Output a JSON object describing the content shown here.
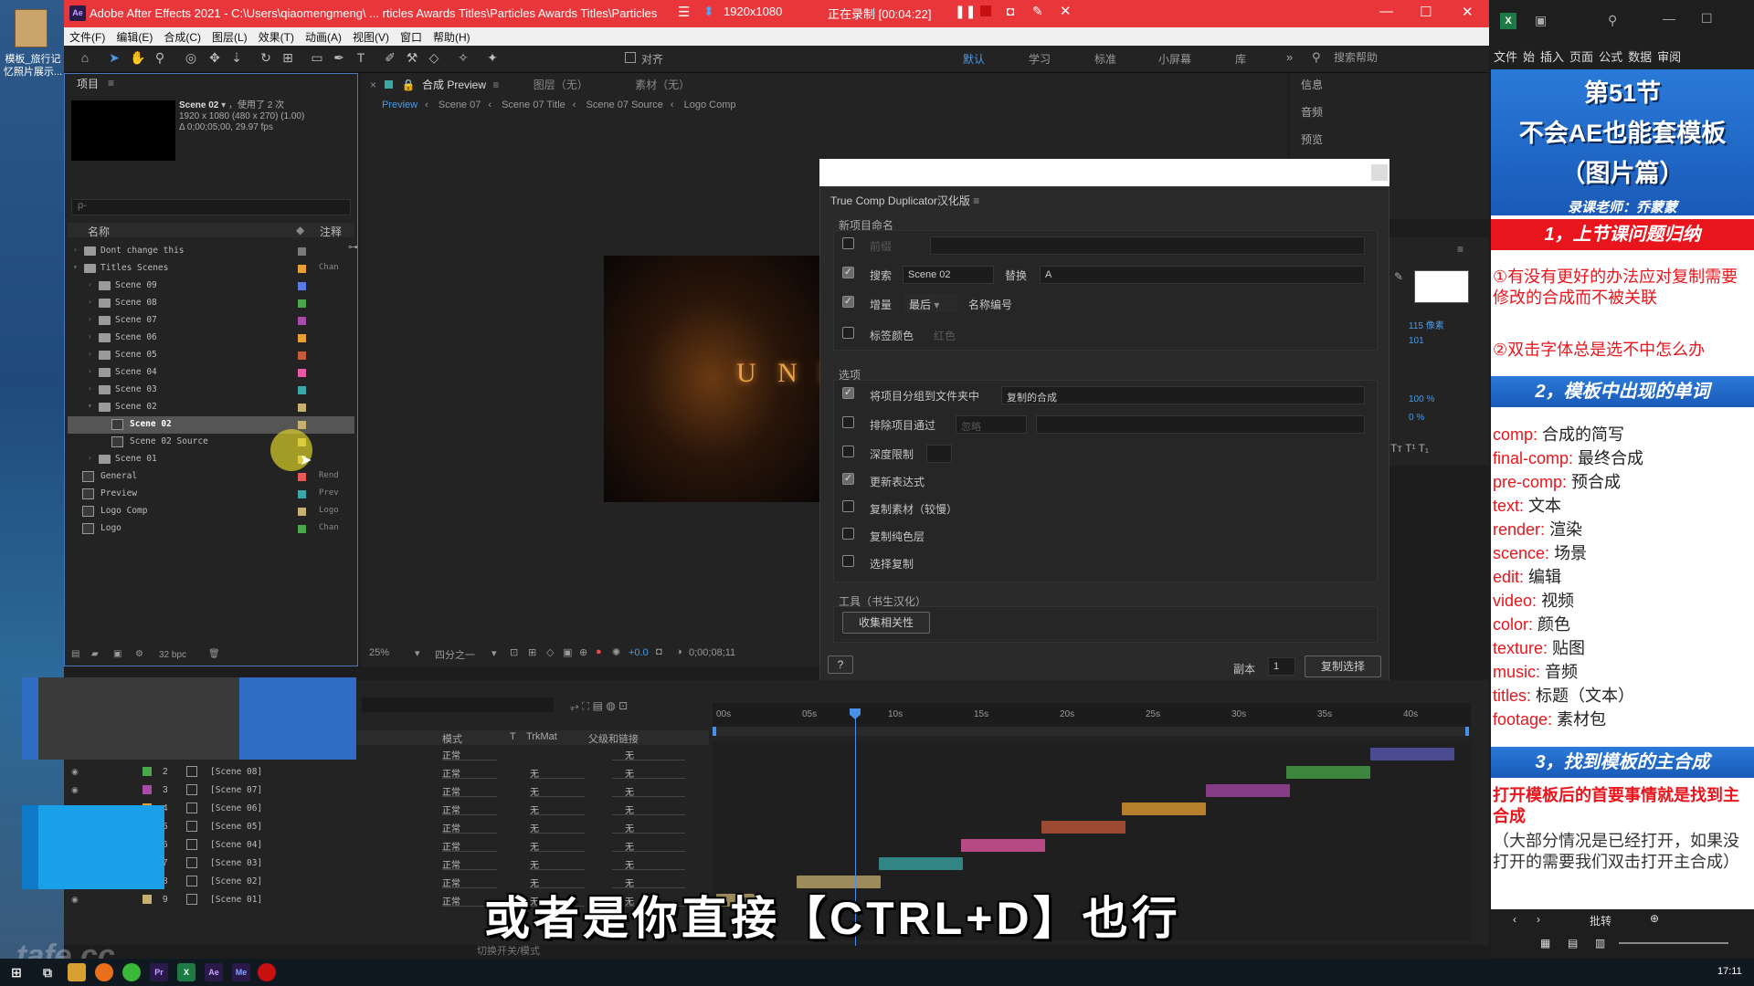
{
  "desktop": {
    "icon_label": "模板_旅行记忆照片展示..."
  },
  "ae": {
    "title": "Adobe After Effects 2021 - C:\\Users\\qiaomengmeng\\ ... rticles Awards Titles\\Particles Awards Titles\\Particles",
    "logo": "Ae",
    "recording": {
      "resolution": "1920x1080",
      "status": "正在录制 [00:04:22]"
    },
    "menu": [
      "文件(F)",
      "编辑(E)",
      "合成(C)",
      "图层(L)",
      "效果(T)",
      "动画(A)",
      "视图(V)",
      "窗口",
      "帮助(H)"
    ],
    "toolbar": {
      "align_label": "对齐",
      "workspaces": [
        "默认",
        "学习",
        "标准",
        "小屏幕",
        "库"
      ],
      "search_placeholder": "搜索帮助"
    }
  },
  "project": {
    "tab": "项目",
    "comp_name": "Scene 02",
    "comp_usage": "，使用了 2 次",
    "comp_size": "1920 x 1080 (480 x 270) (1.00)",
    "comp_duration": "Δ 0;00;05;00, 29.97 fps",
    "search_placeholder": "ρ-",
    "col_name": "名称",
    "col_note": "注释",
    "rows": [
      {
        "name": "Dont change this",
        "type": "folder",
        "indent": 0,
        "color": "#7a7a7a",
        "note": ""
      },
      {
        "name": "Titles Scenes",
        "type": "folder",
        "indent": 0,
        "color": "#e8a030",
        "note": "Chan"
      },
      {
        "name": "Scene 09",
        "type": "folder",
        "indent": 1,
        "color": "#5a7ae8",
        "note": ""
      },
      {
        "name": "Scene 08",
        "type": "folder",
        "indent": 1,
        "color": "#4aa84a",
        "note": ""
      },
      {
        "name": "Scene 07",
        "type": "folder",
        "indent": 1,
        "color": "#a84aa8",
        "note": ""
      },
      {
        "name": "Scene 06",
        "type": "folder",
        "indent": 1,
        "color": "#e8a030",
        "note": ""
      },
      {
        "name": "Scene 05",
        "type": "folder",
        "indent": 1,
        "color": "#c85a3a",
        "note": ""
      },
      {
        "name": "Scene 04",
        "type": "folder",
        "indent": 1,
        "color": "#e85aa8",
        "note": ""
      },
      {
        "name": "Scene 03",
        "type": "folder",
        "indent": 1,
        "color": "#3aa8a8",
        "note": ""
      },
      {
        "name": "Scene 02",
        "type": "folder",
        "indent": 1,
        "color": "#c8b070",
        "note": ""
      },
      {
        "name": "Scene 02",
        "type": "comp",
        "indent": 2,
        "color": "#c8b070",
        "note": "",
        "selected": true
      },
      {
        "name": "Scene 02 Source",
        "type": "comp",
        "indent": 2,
        "color": "#c8b070",
        "note": ""
      },
      {
        "name": "Scene 01",
        "type": "folder",
        "indent": 1,
        "color": "#c8b070",
        "note": ""
      },
      {
        "name": "General",
        "type": "comp",
        "indent": 0,
        "color": "#e85a5a",
        "note": "Rend"
      },
      {
        "name": "Preview",
        "type": "comp",
        "indent": 0,
        "color": "#3aa8a8",
        "note": "Prev"
      },
      {
        "name": "Logo Comp",
        "type": "comp",
        "indent": 0,
        "color": "#c8b070",
        "note": "Logo"
      },
      {
        "name": "Logo",
        "type": "comp",
        "indent": 0,
        "color": "#4aa84a",
        "note": "Chan"
      }
    ],
    "bpc": "32 bpc"
  },
  "comp": {
    "tab_label": "合成 Preview",
    "tab_layer": "图层（无）",
    "tab_footage": "素材（无）",
    "breadcrumb": [
      "Preview",
      "Scene 07",
      "Scene 07 Title",
      "Scene 07 Source",
      "Logo Comp"
    ],
    "viewer_text": "U N I",
    "zoom": "25%",
    "resolution": "四分之一",
    "exposure": "+0.0",
    "timecode": "0;00;08;11"
  },
  "info_panel": {
    "items": [
      "信息",
      "音频",
      "预览"
    ],
    "font_size": "115 像素",
    "tracking": "101",
    "scale_v": "100 %",
    "baseline": "0 %"
  },
  "dialog": {
    "title": "True Comp Duplicator汉化版",
    "section_rename": "新项目命名",
    "prefix_label": "前缀",
    "search_label": "搜索",
    "search_value": "Scene 02",
    "replace_label": "替换",
    "replace_value": "A",
    "increment_label": "增量",
    "increment_value": "最后",
    "increment_name": "名称编号",
    "label_color_label": "标签颜色",
    "label_color_value": "红色",
    "section_options": "选项",
    "group_label": "将项目分组到文件夹中",
    "group_value": "复制的合成",
    "exclude_label": "排除项目通过",
    "exclude_value": "忽略",
    "depth_label": "深度限制",
    "update_expr_label": "更新表达式",
    "dup_footage_label": "复制素材（较慢）",
    "dup_solids_label": "复制纯色层",
    "selective_label": "选择复制",
    "section_tools": "工具（书生汉化）",
    "collect_button": "收集相关性",
    "help_button": "?",
    "copies_label": "副本",
    "copies_value": "1",
    "duplicate_button": "复制选择"
  },
  "timeline": {
    "col_mode": "模式",
    "col_t": "T",
    "col_trkmat": "TrkMat",
    "col_parent": "父级和链接",
    "ruler": [
      "00s",
      "05s",
      "10s",
      "15s",
      "20s",
      "25s",
      "30s",
      "35s",
      "40s"
    ],
    "mode_value": "正常",
    "none_value": "无",
    "layers": [
      {
        "num": "",
        "name": "",
        "color": "#5a5ab8"
      },
      {
        "num": "2",
        "name": "[Scene 08]",
        "color": "#4aa84a"
      },
      {
        "num": "3",
        "name": "[Scene 07]",
        "color": "#a84aa8"
      },
      {
        "num": "4",
        "name": "[Scene 06]",
        "color": "#e8a030"
      },
      {
        "num": "5",
        "name": "[Scene 05]",
        "color": "#c85a3a"
      },
      {
        "num": "6",
        "name": "[Scene 04]",
        "color": "#e85aa8"
      },
      {
        "num": "7",
        "name": "[Scene 03]",
        "color": "#3aa8a8"
      },
      {
        "num": "8",
        "name": "[Scene 02]",
        "color": "#c8b070"
      },
      {
        "num": "9",
        "name": "[Scene 01]",
        "color": "#c8b070"
      }
    ],
    "footer_toggle": "切换开关/模式"
  },
  "subtitle": "或者是你直接【CTRL+D】也行",
  "watermark": "tafe.cc",
  "notes": {
    "ribbon": [
      "文件",
      "始",
      "插入",
      "页面",
      "公式",
      "数据",
      "审阅"
    ],
    "h1": "第51节",
    "h2": "不会AE也能套模板",
    "h3": "（图片篇）",
    "teacher": "录课老师：乔蒙蒙",
    "sec1": "1，上节课问题归纳",
    "q1": "①有没有更好的办法应对复制需要修改的合成而不被关联",
    "q2": "②双击字体总是选不中怎么办",
    "sec2": "2，模板中出现的单词",
    "vocab": [
      {
        "en": "comp:",
        "zh": "合成的简写"
      },
      {
        "en": "final-comp:",
        "zh": "最终合成"
      },
      {
        "en": "pre-comp:",
        "zh": "预合成"
      },
      {
        "en": "text:",
        "zh": "文本"
      },
      {
        "en": "render:",
        "zh": "渲染"
      },
      {
        "en": "scence:",
        "zh": "场景"
      },
      {
        "en": "edit:",
        "zh": "编辑"
      },
      {
        "en": "video:",
        "zh": "视频"
      },
      {
        "en": "color:",
        "zh": "颜色"
      },
      {
        "en": "texture:",
        "zh": "贴图"
      },
      {
        "en": "music:",
        "zh": "音频"
      },
      {
        "en": "titles:",
        "zh": "标题（文本）"
      },
      {
        "en": "footage:",
        "zh": "素材包"
      }
    ],
    "sec3": "3，找到模板的主合成",
    "p3_red": "打开模板后的首要事情就是找到主合成",
    "p3_blue": "（大部分情况是已经打开，如果没打开的需要我们双击打开主合成）",
    "bottom_label": "批转"
  },
  "taskbar": {
    "clock": "17:11"
  }
}
